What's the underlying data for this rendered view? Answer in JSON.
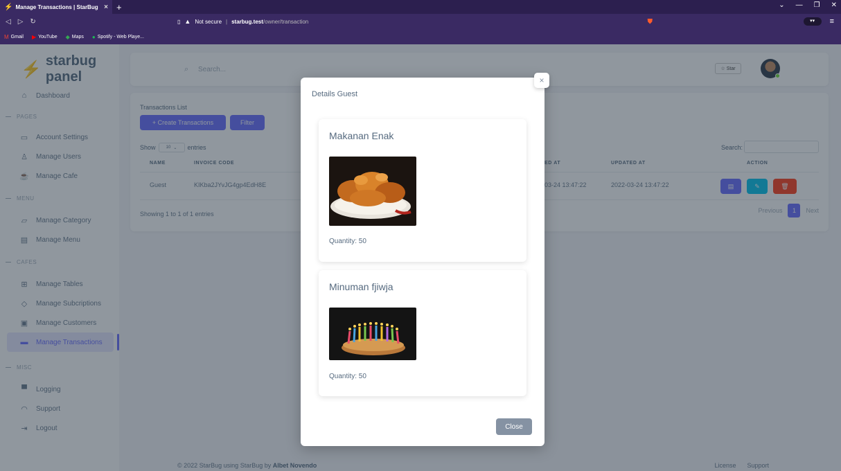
{
  "browser": {
    "tab_title": "Manage Transactions | StarBug",
    "tab_close": "×",
    "new_tab": "+",
    "security_label": "Not secure",
    "url_host": "starbug.test",
    "url_path": "/owner/transaction",
    "bookmarks": [
      {
        "label": "Gmail",
        "icon": "gmail-icon",
        "color": "#ea4335"
      },
      {
        "label": "YouTube",
        "icon": "youtube-icon",
        "color": "#ff0000"
      },
      {
        "label": "Maps",
        "icon": "maps-icon",
        "color": "#34a853"
      },
      {
        "label": "Spotify - Web Playe...",
        "icon": "spotify-icon",
        "color": "#1db954"
      }
    ]
  },
  "brand": {
    "logo_icon": "lightning-icon",
    "name": "starbug panel",
    "accent": "#696cff"
  },
  "sidebar": {
    "dashboard": "Dashboard",
    "pages_header": "PAGES",
    "account_settings": "Account Settings",
    "manage_users": "Manage Users",
    "manage_cafe": "Manage Cafe",
    "menu_header": "MENU",
    "manage_category": "Manage Category",
    "manage_menu": "Manage Menu",
    "cafes_header": "CAFES",
    "manage_tables": "Manage Tables",
    "manage_subscriptions": "Manage Subcriptions",
    "manage_customers": "Manage Customers",
    "manage_transactions": "Manage Transactions",
    "misc_header": "MISC",
    "logging": "Logging",
    "support": "Support",
    "logout": "Logout"
  },
  "topnav": {
    "search_placeholder": "Search...",
    "star_label": "Star"
  },
  "transactions": {
    "title": "Transactions List",
    "create_button": "+ Create Transactions",
    "filter_button": "Filter",
    "show_label": "Show",
    "page_size": "10",
    "entries_label": "entries",
    "search_label": "Search:",
    "columns": {
      "name": "NAME",
      "invoice_code": "INVOICE CODE",
      "created_at": "ED AT",
      "updated_at": "UPDATED AT",
      "action": "ACTION"
    },
    "row": {
      "name": "Guest",
      "invoice_code": "KIKba2JYvJG4gp4EdH8E",
      "created_at": "03-24 13:47:22",
      "updated_at": "2022-03-24 13:47:22"
    },
    "showing_info": "Showing 1 to 1 of 1 entries",
    "pager": {
      "previous": "Previous",
      "current": "1",
      "next": "Next"
    }
  },
  "footer": {
    "copyright": "© 2022 StarBug using StarBug by ",
    "author": "Albet Novendo",
    "license": "License",
    "support": "Support"
  },
  "modal": {
    "title": "Details Guest",
    "close_x": "×",
    "items": [
      {
        "name": "Makanan Enak",
        "quantity": "Quantity: 50"
      },
      {
        "name": "Minuman fjiwja",
        "quantity": "Quantity: 50"
      }
    ],
    "close_button": "Close"
  }
}
